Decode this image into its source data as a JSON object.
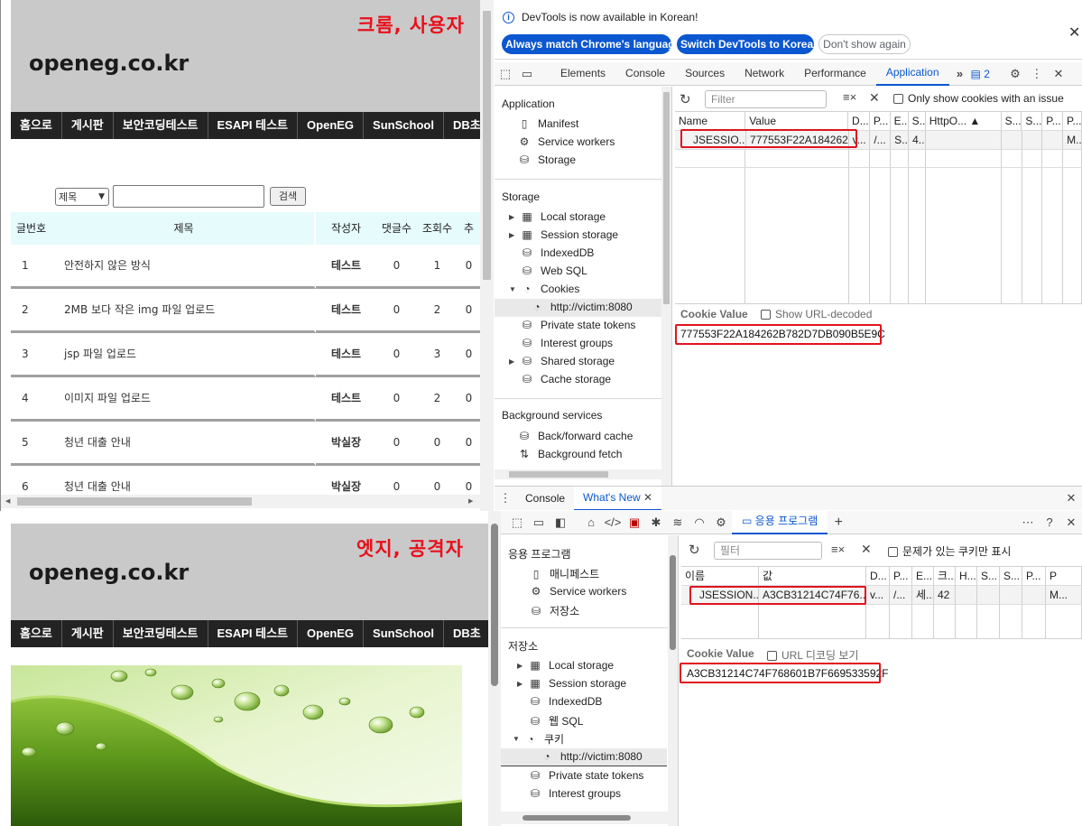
{
  "captions": {
    "chrome": "크롬, 사용자",
    "edge": "엣지, 공격자"
  },
  "colors": {
    "annotation_red": "#e0141e",
    "nav_bg": "#232323",
    "header_bg": "#c9c9c9",
    "devtools_accent": "#0b57d0",
    "board_head_bg": "#e6fbfb"
  },
  "site": {
    "logo": "openeg.co.kr",
    "nav": [
      "홈으로",
      "게시판",
      "보안코딩테스트",
      "ESAPI 테스트",
      "OpenEG",
      "SunSchool",
      "DB초"
    ],
    "search": {
      "select_value": "제목",
      "button": "검색"
    },
    "board": {
      "headers": [
        "글번호",
        "제목",
        "작성자",
        "댓글수",
        "조회수",
        "추"
      ],
      "rows": [
        {
          "no": "1",
          "title": "안전하지 않은 방식",
          "writer": "테스트",
          "replies": "0",
          "views": "1",
          "rec": "0"
        },
        {
          "no": "2",
          "title": "2MB 보다 작은 img 파일 업로드",
          "writer": "테스트",
          "replies": "0",
          "views": "2",
          "rec": "0"
        },
        {
          "no": "3",
          "title": "jsp 파일 업로드",
          "writer": "테스트",
          "replies": "0",
          "views": "3",
          "rec": "0"
        },
        {
          "no": "4",
          "title": "이미지 파일 업로드",
          "writer": "테스트",
          "replies": "0",
          "views": "2",
          "rec": "0"
        },
        {
          "no": "5",
          "title": "청년 대출 안내",
          "writer": "박실장",
          "replies": "0",
          "views": "0",
          "rec": "0"
        },
        {
          "no": "6",
          "title": "청년 대출 안내",
          "writer": "박실장",
          "replies": "0",
          "views": "0",
          "rec": "0"
        }
      ]
    }
  },
  "chrome_devtools": {
    "info_text": "DevTools is now available in Korean!",
    "btn_match": "Always match Chrome's language",
    "btn_switch": "Switch DevTools to Korean",
    "btn_dont": "Don't show again",
    "tabs": [
      "Elements",
      "Console",
      "Sources",
      "Network",
      "Performance",
      "Application"
    ],
    "issues_count": "2",
    "sidebar": {
      "application_title": "Application",
      "application_items": [
        "Manifest",
        "Service workers",
        "Storage"
      ],
      "storage_title": "Storage",
      "storage_items": [
        "Local storage",
        "Session storage",
        "IndexedDB",
        "Web SQL",
        "Cookies"
      ],
      "cookie_origin": "http://victim:8080",
      "storage_items2": [
        "Private state tokens",
        "Interest groups",
        "Shared storage",
        "Cache storage"
      ],
      "bg_title": "Background services",
      "bg_items": [
        "Back/forward cache",
        "Background fetch"
      ]
    },
    "filter_placeholder": "Filter",
    "only_issue_label": "Only show cookies with an issue",
    "columns": [
      "Name",
      "Value",
      "D...",
      "P...",
      "E...",
      "S...",
      "HttpO... ▲",
      "S...",
      "S...",
      "P...",
      "P..."
    ],
    "row": [
      "JSESSIO...",
      "777553F22A184262...",
      "v...",
      "/...",
      "S...",
      "4...",
      "",
      "",
      "",
      "",
      "M..."
    ],
    "cookie_value_label": "Cookie Value",
    "show_url_decoded": "Show URL-decoded",
    "cookie_value": "777553F22A184262B782D7DB090B5E9C",
    "drawer_tabs": [
      "Console",
      "What's New"
    ]
  },
  "edge_devtools": {
    "active_tab": "응용 프로그램",
    "sidebar": {
      "application_title": "응용 프로그램",
      "application_items": [
        "매니페스트",
        "Service workers",
        "저장소"
      ],
      "storage_title": "저장소",
      "storage_items": [
        "Local storage",
        "Session storage",
        "IndexedDB",
        "웹 SQL",
        "쿠키"
      ],
      "cookie_origin": "http://victim:8080",
      "storage_items2": [
        "Private state tokens",
        "Interest groups"
      ]
    },
    "filter_placeholder": "필터",
    "only_issue_label": "문제가 있는 쿠키만 표시",
    "columns": [
      "이름",
      "값",
      "D...",
      "P...",
      "E...",
      "크...",
      "H...",
      "S...",
      "S...",
      "P...",
      "P"
    ],
    "row": [
      "JSESSION...",
      "A3CB31214C74F76...",
      "v...",
      "/...",
      "세...",
      "42",
      "",
      "",
      "",
      "",
      "M..."
    ],
    "cookie_value_label": "Cookie Value",
    "show_url_decoded": "URL 디코딩 보기",
    "cookie_value": "A3CB31214C74F768601B7F669533592F"
  }
}
